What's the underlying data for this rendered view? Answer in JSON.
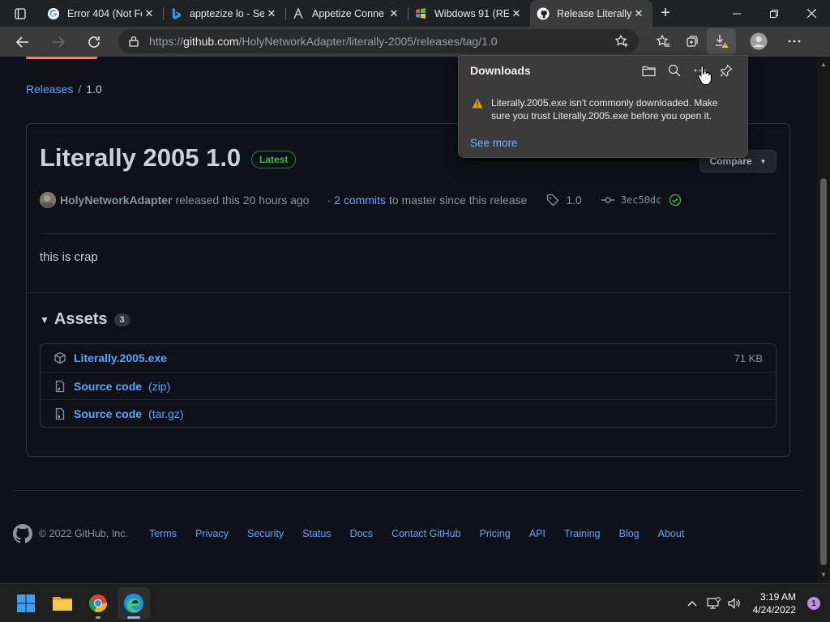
{
  "browser": {
    "tabs": [
      {
        "title": "Error 404 (Not Fo",
        "icon": "google-icon"
      },
      {
        "title": "apptezize lo - Se",
        "icon": "bing-icon"
      },
      {
        "title": "Appetize Conne",
        "icon": "appetize-icon"
      },
      {
        "title": "Wibdows 91 (RE",
        "icon": "windows91-icon"
      },
      {
        "title": "Release Literally",
        "icon": "github-icon",
        "active": true
      }
    ],
    "address": {
      "prefix": "https://",
      "host": "github.com",
      "path": "/HolyNetworkAdapter/literally-2005/releases/tag/1.0"
    }
  },
  "page": {
    "breadcrumb": {
      "releases": "Releases",
      "sep": "/",
      "current": "1.0"
    },
    "release": {
      "title": "Literally 2005 1.0",
      "badge": "Latest",
      "compare_label": "Compare",
      "author": "HolyNetworkAdapter",
      "released_text": "released this 20 hours ago",
      "commits_prefix": "·",
      "commits_link": "2 commits",
      "commits_suffix": "to master since this release",
      "tag": "1.0",
      "sha": "3ec50dc",
      "body": "this is crap"
    },
    "assets": {
      "heading": "Assets",
      "count": "3",
      "items": [
        {
          "name": "Literally.2005.exe",
          "format": "",
          "size": "71 KB",
          "icon": "package-icon"
        },
        {
          "name": "Source code",
          "format": "(zip)",
          "size": "",
          "icon": "file-zip-icon"
        },
        {
          "name": "Source code",
          "format": "(tar.gz)",
          "size": "",
          "icon": "file-zip-icon"
        }
      ]
    },
    "footer": {
      "copyright": "© 2022 GitHub, Inc.",
      "links": [
        "Terms",
        "Privacy",
        "Security",
        "Status",
        "Docs",
        "Contact GitHub",
        "Pricing",
        "API",
        "Training",
        "Blog",
        "About"
      ]
    }
  },
  "downloads": {
    "title": "Downloads",
    "warning": "Literally.2005.exe isn't commonly downloaded. Make sure you trust Literally.2005.exe before you open it.",
    "see_more": "See more"
  },
  "taskbar": {
    "time": "3:19 AM",
    "date": "4/24/2022",
    "notifications": "1"
  },
  "colors": {
    "accent_link": "#58a6ff",
    "latest_green": "#3fb950",
    "warning_amber": "#e3a008"
  }
}
